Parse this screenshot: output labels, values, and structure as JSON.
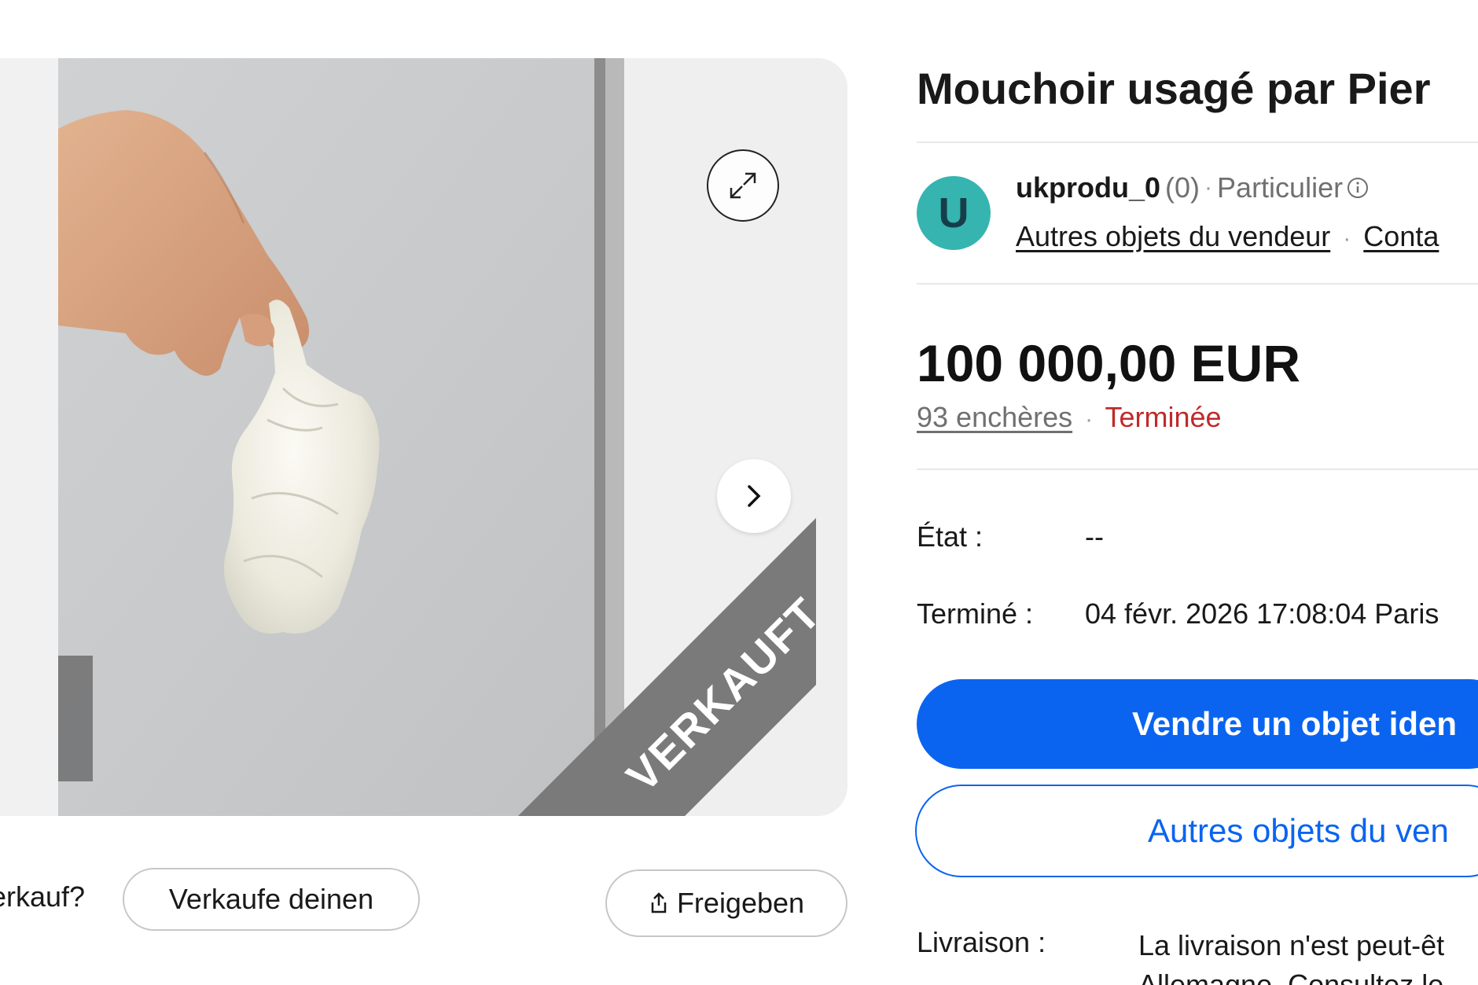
{
  "gallery": {
    "ribbon": "VERKAUFT",
    "expand_icon": "expand-arrows-icon",
    "next_icon": "chevron-right-icon"
  },
  "actions": {
    "sell_question": "erkauf?",
    "sell_button": "Verkaufe deinen",
    "share_button": "Freigeben",
    "share_icon": "share-icon"
  },
  "listing": {
    "title": "Mouchoir usagé par Pier"
  },
  "seller": {
    "avatar_letter": "U",
    "name": "ukprodu_0",
    "rating": "(0)",
    "type": "Particulier",
    "other_items_link": "Autres objets du vendeur",
    "contact_link": "Conta"
  },
  "price": {
    "amount": "100 000,00 EUR",
    "bids": "93 enchères",
    "status": "Terminée"
  },
  "details": {
    "condition_label": "État :",
    "condition_value": "--",
    "ended_label": "Terminé :",
    "ended_value": "04 févr. 2026 17:08:04 Paris"
  },
  "buttons": {
    "sell_similar": "Vendre un objet iden",
    "other_items": "Autres objets du ven"
  },
  "delivery": {
    "label": "Livraison :",
    "text": "La livraison n'est peut-êt Allemagne. Consultez le"
  },
  "colors": {
    "primary_blue": "#0a64f0",
    "ended_red": "#c02a2a",
    "avatar_teal": "#36b4b0",
    "ribbon_gray": "#7a7a7a"
  }
}
